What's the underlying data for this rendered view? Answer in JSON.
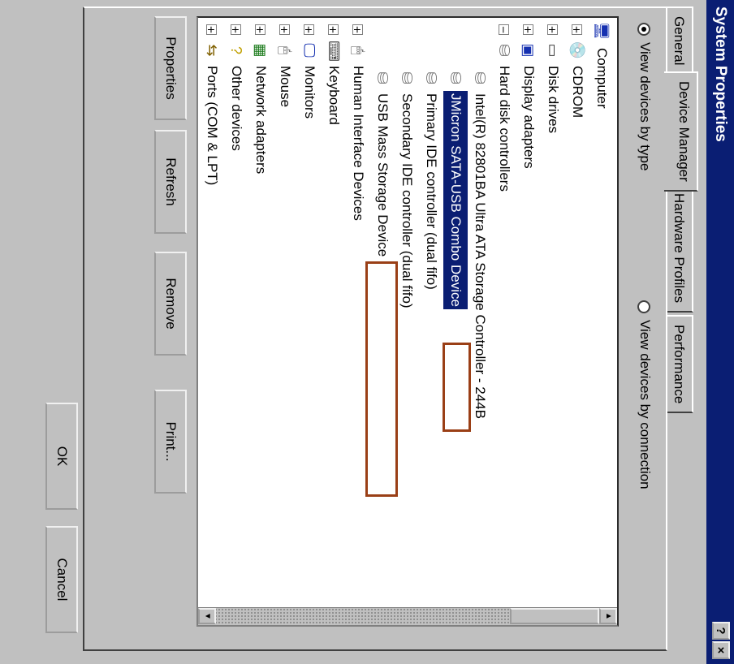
{
  "title": "System Properties",
  "title_buttons": {
    "help": "?",
    "close": "×"
  },
  "tabs": [
    {
      "label": "General"
    },
    {
      "label": "Device Manager"
    },
    {
      "label": "Hardware Profiles"
    },
    {
      "label": "Performance"
    }
  ],
  "view_options": {
    "by_type": "View devices by type",
    "by_connection": "View devices by connection",
    "selected": "by_type"
  },
  "tree": [
    {
      "label": "Computer",
      "icon": "computer-icon"
    },
    {
      "label": "CDROM",
      "icon": "cdrom-icon"
    },
    {
      "label": "Disk drives",
      "icon": "disk-drive-icon"
    },
    {
      "label": "Display adapters",
      "icon": "display-adapter-icon"
    },
    {
      "label": "Hard disk controllers",
      "icon": "hard-disk-controller-icon"
    },
    {
      "label": "Intel(R) 82801BA Ultra ATA Storage Controller - 244B",
      "icon": "controller-icon"
    },
    {
      "label": "JMicron SATA-USB Combo Device",
      "icon": "controller-icon",
      "selected": true
    },
    {
      "label": "Primary IDE controller (dual fifo)",
      "icon": "controller-icon"
    },
    {
      "label": "Secondary IDE controller (dual fifo)",
      "icon": "controller-icon"
    },
    {
      "label": "USB Mass Storage Device",
      "icon": "controller-icon"
    },
    {
      "label": "Human Interface Devices",
      "icon": "hid-icon"
    },
    {
      "label": "Keyboard",
      "icon": "keyboard-icon"
    },
    {
      "label": "Monitors",
      "icon": "monitor-icon"
    },
    {
      "label": "Mouse",
      "icon": "mouse-icon"
    },
    {
      "label": "Network adapters",
      "icon": "network-adapter-icon"
    },
    {
      "label": "Other devices",
      "icon": "other-devices-icon"
    },
    {
      "label": "Ports (COM & LPT)",
      "icon": "ports-icon"
    }
  ],
  "buttons": {
    "properties": "Properties",
    "refresh": "Refresh",
    "remove": "Remove",
    "print": "Print...",
    "ok": "OK",
    "cancel": "Cancel"
  },
  "colors": {
    "titlebar": "#0a1e73",
    "selection": "#0a1e73",
    "highlight_box": "#9a3f16",
    "face": "#c0c0c0"
  }
}
